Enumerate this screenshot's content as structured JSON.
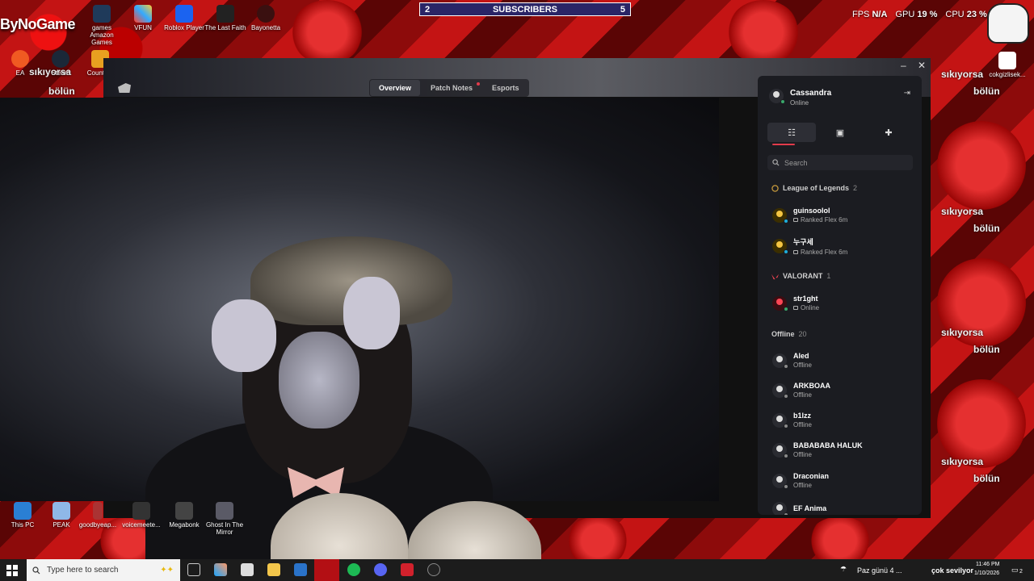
{
  "desktop": {
    "brand": "ByNoGame",
    "icons_top": [
      {
        "label": "games\nAmazon\nGames"
      },
      {
        "label": "VFUN"
      },
      {
        "label": "Roblox Player"
      },
      {
        "label": "The Last Faith"
      },
      {
        "label": "Bayonetta"
      }
    ],
    "icons_left": [
      {
        "label": "EA"
      },
      {
        "label": "Steam"
      },
      {
        "label": "Counte..."
      }
    ],
    "icons_bottom": [
      {
        "label": "This PC"
      },
      {
        "label": "PEAK"
      },
      {
        "label": "goodbyeap..."
      },
      {
        "label": "voicemeete..."
      },
      {
        "label": "Megabonk"
      },
      {
        "label": "Ghost In The Mirror"
      }
    ],
    "right_icon_label": "cokgizlisek...",
    "wallpaper_texts": [
      "sıkıyorsa",
      "bölün"
    ]
  },
  "overlay": {
    "subs_left": "2",
    "subs_title": "SUBSCRIBERS",
    "subs_right": "5",
    "fps_label": "FPS",
    "fps_value": "N/A",
    "gpu_label": "GPU",
    "gpu_value": "19 %",
    "cpu_label": "CPU",
    "cpu_value": "23 %"
  },
  "client": {
    "tabs": [
      "Overview",
      "Patch Notes",
      "Esports"
    ],
    "active_tab": "Overview",
    "minimize": "–",
    "close": "✕"
  },
  "social": {
    "me": {
      "name": "Cassandra",
      "status": "Online"
    },
    "search_placeholder": "Search",
    "groups": [
      {
        "name": "League of Legends",
        "count": "2"
      },
      {
        "name": "VALORANT",
        "count": "1"
      },
      {
        "name": "Offline",
        "count": "20"
      }
    ],
    "lol_friends": [
      {
        "name": "guinsoolol",
        "status": "Ranked Flex 6m"
      },
      {
        "name": "누구세",
        "status": "Ranked Flex 6m"
      }
    ],
    "valorant_friends": [
      {
        "name": "str1ght",
        "status": "Online"
      }
    ],
    "offline_friends": [
      {
        "name": "Aled",
        "status": "Offline"
      },
      {
        "name": "ARKBOAA",
        "status": "Offline"
      },
      {
        "name": "b1lzz",
        "status": "Offline"
      },
      {
        "name": "BABABABA HALUK",
        "status": "Offline"
      },
      {
        "name": "Draconian",
        "status": "Offline"
      },
      {
        "name": "EF Anima",
        "status": ""
      }
    ]
  },
  "taskbar": {
    "search_placeholder": "Type here to search",
    "weather": "Paz günü 4 ...",
    "language_hint": "çok sevilyor",
    "time": "11:46 PM",
    "date": "1/10/2026",
    "notifications": "2"
  }
}
